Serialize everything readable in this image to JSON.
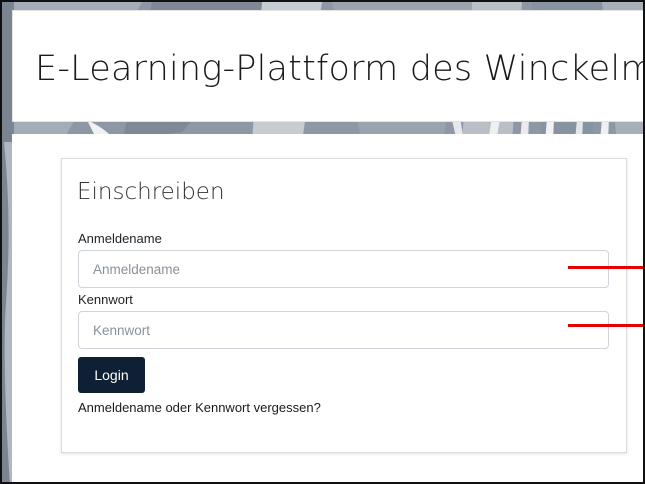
{
  "site": {
    "title": "E-Learning-Plattform des Winckelmann"
  },
  "login": {
    "heading": "Einschreiben",
    "username_label": "Anmeldename",
    "username_placeholder": "Anmeldename",
    "username_value": "",
    "password_label": "Kennwort",
    "password_placeholder": "Kennwort",
    "password_value": "",
    "submit_label": "Login",
    "forgot_link": "Anmeldename oder Kennwort vergessen?"
  },
  "colors": {
    "button_bg": "#0f2035",
    "annotation": "#e50000",
    "background_photo": "#8e98a4"
  }
}
